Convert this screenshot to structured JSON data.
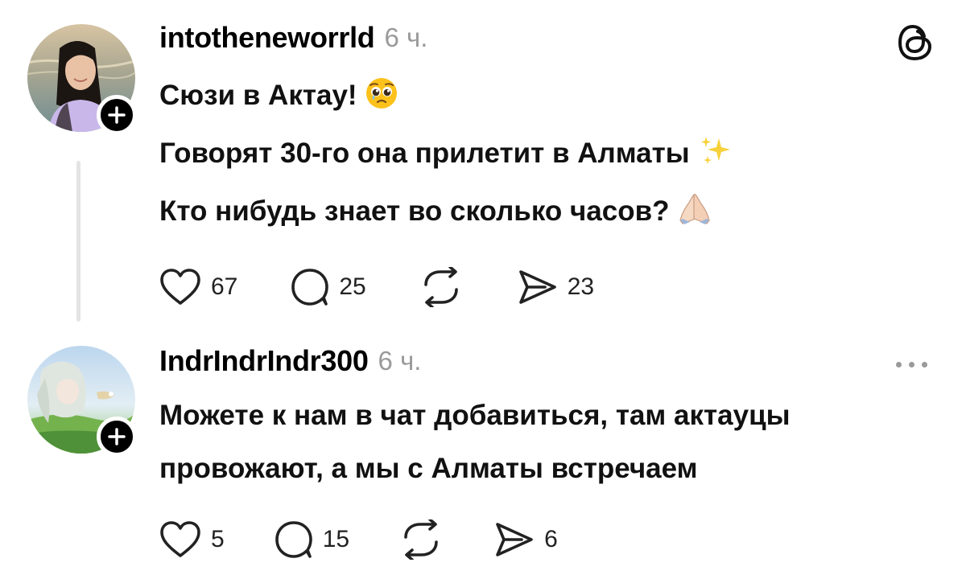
{
  "posts": [
    {
      "username": "intotheneworrld",
      "time": "6 ч.",
      "lines": [
        "Сюзи в Актау!",
        "Говорят 30-го она прилетит в Алматы",
        "Кто нибудь знает во сколько часов?"
      ],
      "line_emojis": [
        "pleading-face-emoji",
        "sparkles-emoji",
        "folded-hands-emoji"
      ],
      "avatar": "woman-portrait-photo",
      "likes": "67",
      "replies": "25",
      "shares": "23",
      "corner_icon": "threads-logo-icon"
    },
    {
      "username": "IndrIndrIndr300",
      "time": "6 ч.",
      "lines": [
        "Можете к нам в чат добавиться, там актауцы",
        "провожают, а мы с Алматы встречаем"
      ],
      "avatar": "anime-girl-illustration",
      "likes": "5",
      "replies": "15",
      "shares": "6",
      "corner_icon": "more-options-icon"
    }
  ],
  "colors": {
    "text": "#000000",
    "muted": "#9a9a9a",
    "thread_line": "#e4e4e4",
    "background": "#ffffff"
  }
}
